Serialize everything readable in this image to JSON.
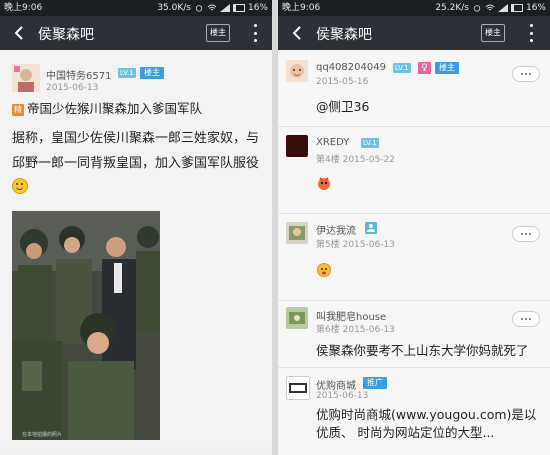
{
  "left": {
    "status": {
      "time": "晚上9:06",
      "speed": "35.0K/s",
      "battery": "16%"
    },
    "appbar": {
      "title": "侯聚森吧",
      "owner_label": "楼主"
    },
    "post": {
      "username": "中国特务6571",
      "level": "LV.1",
      "owner_badge": "楼主",
      "date": "2015-06-13",
      "floor_badge": "精",
      "title": "帝国少佐猴川聚森加入爹国军队",
      "body": "据称，皇国少佐侯川聚森一郎三姓家奴，与邱野一郎一同背叛皇国，加入爹国军队服役",
      "photo_caption": "在本地拍摄的照片"
    }
  },
  "right": {
    "status": {
      "time": "晚上9:06",
      "speed": "25.2K/s",
      "battery": "16%"
    },
    "appbar": {
      "title": "侯聚森吧",
      "owner_label": "楼主"
    },
    "replies": [
      {
        "username": "qq408204049",
        "level": "LV.1",
        "gender": "♀",
        "owner_badge": "楼主",
        "meta": "2015-05-16",
        "content": "@侧卫36"
      },
      {
        "username": "XREDY",
        "level": "LV.1",
        "meta": "第4楼  2015-05-22",
        "content": ""
      },
      {
        "username": "伊达我流",
        "meta": "第5楼  2015-06-13",
        "content": ""
      },
      {
        "username": "叫我肥皂house",
        "meta": "第6楼  2015-06-13",
        "content": "侯聚森你要考不上山东大学你妈就死了"
      },
      {
        "username": "优购商城",
        "promo": "推广",
        "meta": "2015-06-13",
        "content": "优购时尚商城(www.yougou.com)是以优质、 时尚为网站定位的大型..."
      }
    ]
  }
}
